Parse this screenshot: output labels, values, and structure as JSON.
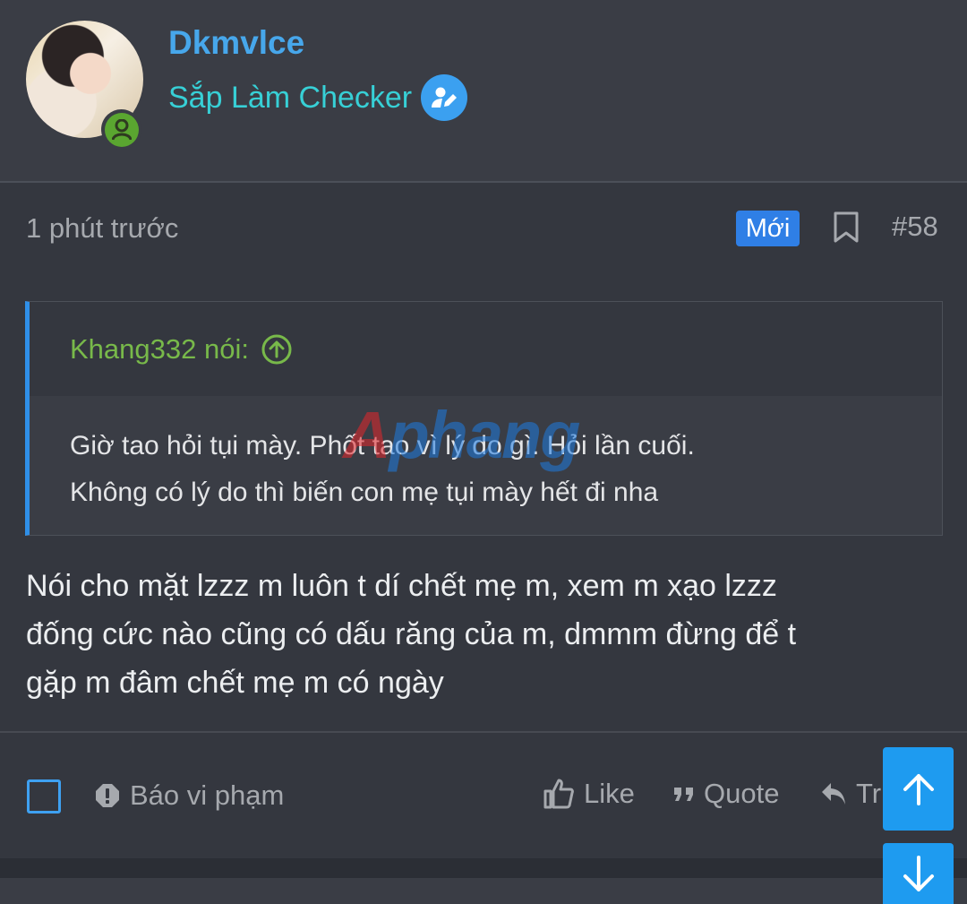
{
  "user": {
    "name": "Dkmvlce",
    "title": "Sắp Làm Checker"
  },
  "post": {
    "time": "1 phút trước",
    "new_badge": "Mới",
    "number": "#58"
  },
  "quote": {
    "author_line": "Khang332 nói:",
    "lines": [
      "Giờ tao hỏi tụi mày. Phốt tao vì lý do gì. Hỏi lần cuối.",
      "Không có lý do thì biến con mẹ tụi mày hết đi nha"
    ]
  },
  "watermark": {
    "part1": "A",
    "part2": "phang"
  },
  "message": {
    "lines": [
      "Nói cho mặt lzzz m luôn t dí chết mẹ m, xem m xạo lzzz",
      "đống cức nào cũng có dấu răng của m, dmmm đừng để t",
      "gặp m đâm chết mẹ m có ngày"
    ]
  },
  "footer": {
    "report": "Báo vi phạm",
    "like": "Like",
    "quote": "Quote",
    "reply": "Tr"
  },
  "colors": {
    "accent_blue": "#2f8fe8",
    "username": "#47a7eb",
    "title": "#37d0d6",
    "quote_author": "#78b94a",
    "online": "#5aa630"
  },
  "icons": {
    "online": "user-icon",
    "verified": "user-edit-icon",
    "bookmark": "bookmark-icon",
    "quote_jump": "arrow-circle-up-icon",
    "report": "exclamation-octagon-icon",
    "like": "thumbs-up-icon",
    "quote": "quote-icon",
    "reply": "reply-icon",
    "scroll_up": "arrow-up-icon",
    "scroll_down": "arrow-down-icon"
  }
}
